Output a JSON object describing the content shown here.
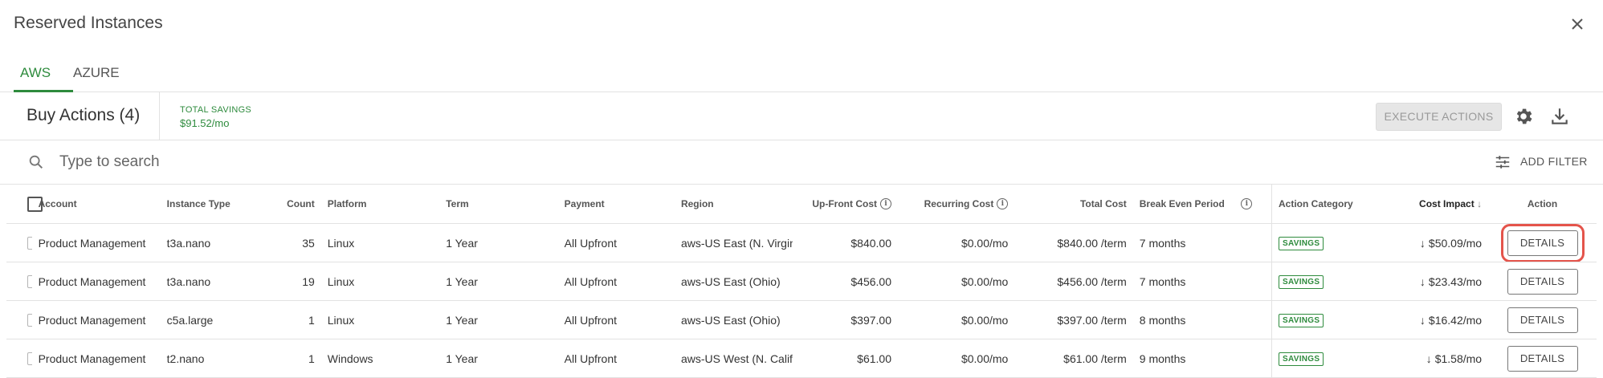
{
  "dialog": {
    "title": "Reserved Instances"
  },
  "tabs": [
    {
      "label": "AWS",
      "active": true
    },
    {
      "label": "AZURE",
      "active": false
    }
  ],
  "toolbar": {
    "buy_actions_label": "Buy Actions (4)",
    "total_savings_label": "TOTAL SAVINGS",
    "total_savings_value": "$91.52/mo",
    "execute_label": "EXECUTE ACTIONS"
  },
  "search": {
    "placeholder": "Type to search",
    "add_filter_label": "ADD FILTER"
  },
  "table": {
    "headers": {
      "account": "Account",
      "instance_type": "Instance Type",
      "count": "Count",
      "platform": "Platform",
      "term": "Term",
      "payment": "Payment",
      "region": "Region",
      "upfront": "Up-Front Cost",
      "recurring": "Recurring Cost",
      "total": "Total Cost",
      "break_even": "Break Even Period",
      "action_category": "Action Category",
      "cost_impact": "Cost Impact",
      "cost_impact_sort": "↓",
      "action": "Action"
    },
    "rows": [
      {
        "account": "Product Management",
        "instance_type": "t3a.nano",
        "count": "35",
        "platform": "Linux",
        "term": "1 Year",
        "payment": "All Upfront",
        "region": "aws-US East (N. Virginia)",
        "upfront": "$840.00",
        "recurring": "$0.00/mo",
        "total": "$840.00 /term",
        "break_even": "7 months",
        "category": "SAVINGS",
        "impact": "$50.09/mo",
        "action": "DETAILS"
      },
      {
        "account": "Product Management",
        "instance_type": "t3a.nano",
        "count": "19",
        "platform": "Linux",
        "term": "1 Year",
        "payment": "All Upfront",
        "region": "aws-US East (Ohio)",
        "upfront": "$456.00",
        "recurring": "$0.00/mo",
        "total": "$456.00 /term",
        "break_even": "7 months",
        "category": "SAVINGS",
        "impact": "$23.43/mo",
        "action": "DETAILS"
      },
      {
        "account": "Product Management",
        "instance_type": "c5a.large",
        "count": "1",
        "platform": "Linux",
        "term": "1 Year",
        "payment": "All Upfront",
        "region": "aws-US East (Ohio)",
        "upfront": "$397.00",
        "recurring": "$0.00/mo",
        "total": "$397.00 /term",
        "break_even": "8 months",
        "category": "SAVINGS",
        "impact": "$16.42/mo",
        "action": "DETAILS"
      },
      {
        "account": "Product Management",
        "instance_type": "t2.nano",
        "count": "1",
        "platform": "Windows",
        "term": "1 Year",
        "payment": "All Upfront",
        "region": "aws-US West (N. California)",
        "upfront": "$61.00",
        "recurring": "$0.00/mo",
        "total": "$61.00 /term",
        "break_even": "9 months",
        "category": "SAVINGS",
        "impact": "$1.58/mo",
        "action": "DETAILS"
      }
    ]
  },
  "icons": {
    "close": "close-icon",
    "gear": "gear-icon",
    "download": "download-icon",
    "search": "search-icon",
    "filter": "filter-sliders-icon",
    "info": "info-icon",
    "impact_arrow": "arrow-down-icon"
  },
  "colors": {
    "accent": "#2e8b3d",
    "link": "#2b5f9e",
    "highlight": "#e4544b"
  }
}
